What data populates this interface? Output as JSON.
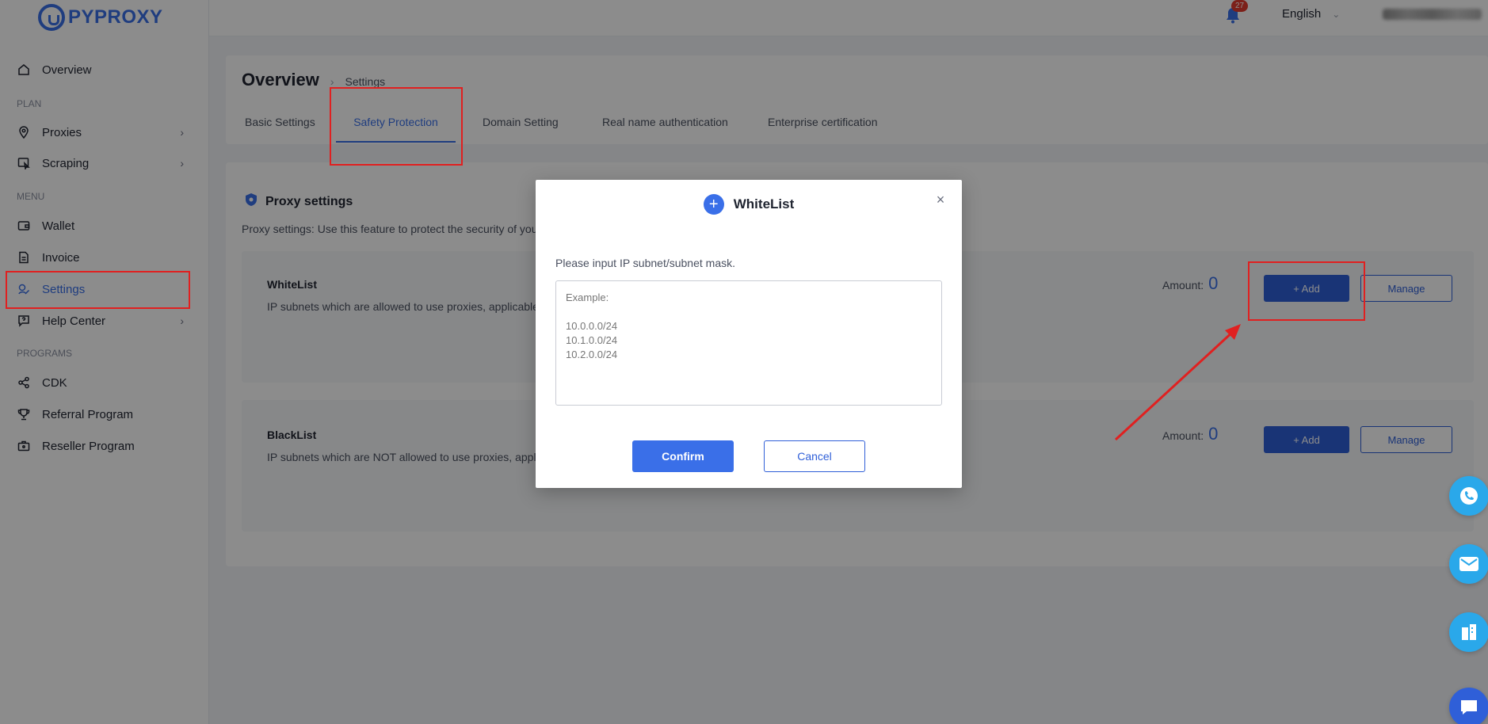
{
  "app": {
    "logo_text": "PYPROXY"
  },
  "topbar": {
    "notification_count": "27",
    "language": "English"
  },
  "sidebar": {
    "overview": "Overview",
    "section_plan": "PLAN",
    "proxies": "Proxies",
    "scraping": "Scraping",
    "section_menu": "MENU",
    "wallet": "Wallet",
    "invoice": "Invoice",
    "settings": "Settings",
    "help_center": "Help Center",
    "section_programs": "PROGRAMS",
    "cdk": "CDK",
    "referral": "Referral Program",
    "reseller": "Reseller Program"
  },
  "header": {
    "title": "Overview",
    "breadcrumb_sub": "Settings",
    "tabs": [
      "Basic Settings",
      "Safety Protection",
      "Domain Setting",
      "Real name authentication",
      "Enterprise certification"
    ]
  },
  "proxy_settings": {
    "title": "Proxy settings",
    "description": "Proxy settings: Use this feature to protect the security of your d",
    "whitelist": {
      "title": "WhiteList",
      "description": "IP subnets which are allowed to use proxies, applicable to",
      "amount_label": "Amount:",
      "amount_value": "0",
      "add_label": "+ Add",
      "manage_label": "Manage"
    },
    "blacklist": {
      "title": "BlackList",
      "description": "IP subnets which are NOT allowed to use proxies, applicab",
      "amount_label": "Amount:",
      "amount_value": "0",
      "add_label": "+ Add",
      "manage_label": "Manage"
    }
  },
  "modal": {
    "title": "WhiteList",
    "label": "Please input IP subnet/subnet mask.",
    "placeholder": "Example:\n\n10.0.0.0/24\n10.1.0.0/24\n10.2.0.0/24",
    "confirm_label": "Confirm",
    "cancel_label": "Cancel"
  },
  "colors": {
    "accent": "#3a6fe8",
    "button_blue": "#2f5fd8",
    "highlight_red": "#e02020",
    "fab_blue": "#2aa8ea"
  }
}
